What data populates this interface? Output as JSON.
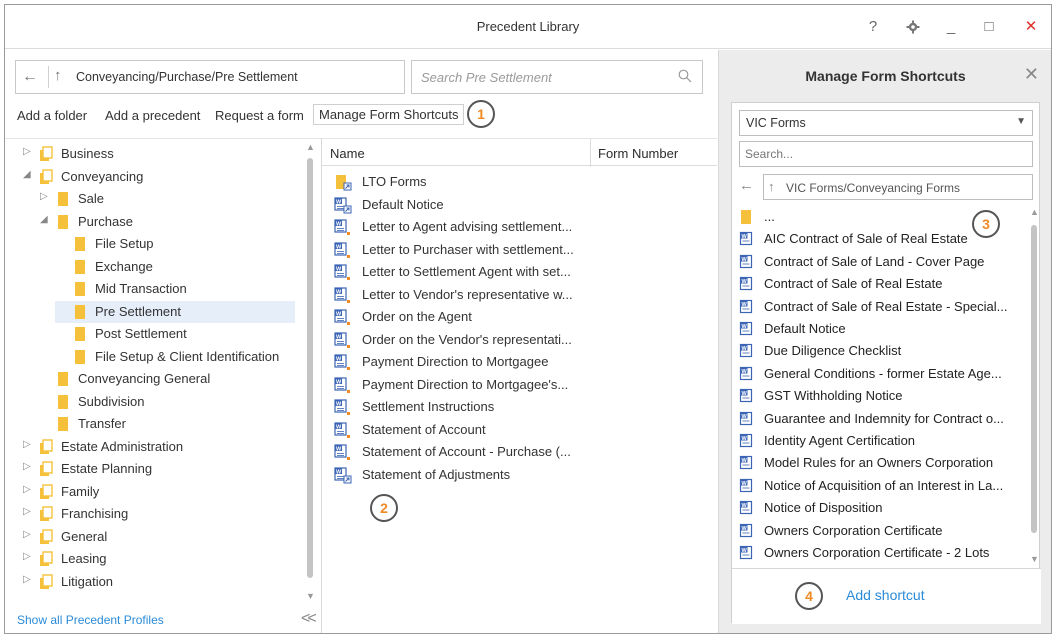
{
  "window": {
    "title": "Precedent Library",
    "controls": {
      "help": "?",
      "minimize": "_",
      "maximize": "□",
      "close": "✕"
    }
  },
  "nav": {
    "path": "Conveyancing/Purchase/Pre Settlement",
    "search_placeholder": "Search Pre Settlement"
  },
  "toolbar": {
    "add_folder": "Add a folder",
    "add_precedent": "Add a precedent",
    "request_form": "Request a form",
    "manage_shortcuts": "Manage Form Shortcuts"
  },
  "callouts": [
    "1",
    "2",
    "3",
    "4"
  ],
  "tree": [
    {
      "label": "Business",
      "level": 0,
      "expander": "collapsed",
      "icon": "multi-folder-icon"
    },
    {
      "label": "Conveyancing",
      "level": 0,
      "expander": "expanded",
      "icon": "multi-folder-icon"
    },
    {
      "label": "Sale",
      "level": 1,
      "expander": "collapsed",
      "icon": "folder-icon"
    },
    {
      "label": "Purchase",
      "level": 1,
      "expander": "expanded",
      "icon": "folder-icon"
    },
    {
      "label": "File Setup",
      "level": 2,
      "expander": "none",
      "icon": "folder-icon"
    },
    {
      "label": "Exchange",
      "level": 2,
      "expander": "none",
      "icon": "folder-icon"
    },
    {
      "label": "Mid Transaction",
      "level": 2,
      "expander": "none",
      "icon": "folder-icon"
    },
    {
      "label": "Pre Settlement",
      "level": 2,
      "expander": "none",
      "icon": "folder-icon",
      "selected": true
    },
    {
      "label": "Post Settlement",
      "level": 2,
      "expander": "none",
      "icon": "folder-icon"
    },
    {
      "label": "File Setup & Client Identification",
      "level": 2,
      "expander": "none",
      "icon": "folder-icon"
    },
    {
      "label": "Conveyancing General",
      "level": 1,
      "expander": "none",
      "icon": "folder-icon"
    },
    {
      "label": "Subdivision",
      "level": 1,
      "expander": "none",
      "icon": "folder-icon"
    },
    {
      "label": "Transfer",
      "level": 1,
      "expander": "none",
      "icon": "folder-icon"
    },
    {
      "label": "Estate Administration",
      "level": 0,
      "expander": "collapsed",
      "icon": "multi-folder-icon"
    },
    {
      "label": "Estate Planning",
      "level": 0,
      "expander": "collapsed",
      "icon": "multi-folder-icon"
    },
    {
      "label": "Family",
      "level": 0,
      "expander": "collapsed",
      "icon": "multi-folder-icon"
    },
    {
      "label": "Franchising",
      "level": 0,
      "expander": "collapsed",
      "icon": "multi-folder-icon"
    },
    {
      "label": "General",
      "level": 0,
      "expander": "collapsed",
      "icon": "multi-folder-icon"
    },
    {
      "label": "Leasing",
      "level": 0,
      "expander": "collapsed",
      "icon": "multi-folder-icon"
    },
    {
      "label": "Litigation",
      "level": 0,
      "expander": "collapsed",
      "icon": "multi-folder-icon"
    }
  ],
  "footer": {
    "show_all": "Show all Precedent Profiles",
    "collapse": "<<"
  },
  "list": {
    "columns": [
      "Name",
      "Form Number"
    ],
    "rows": [
      {
        "name": "LTO Forms",
        "icon": "folder-shortcut-icon"
      },
      {
        "name": "Default Notice",
        "icon": "word-shortcut-icon"
      },
      {
        "name": "Letter to Agent advising settlement...",
        "icon": "word-doc-icon"
      },
      {
        "name": "Letter to Purchaser with settlement...",
        "icon": "word-doc-icon"
      },
      {
        "name": "Letter to Settlement Agent with set...",
        "icon": "word-doc-icon"
      },
      {
        "name": "Letter to Vendor's representative w...",
        "icon": "word-doc-icon"
      },
      {
        "name": "Order on the Agent",
        "icon": "word-doc-icon"
      },
      {
        "name": "Order on the Vendor's representati...",
        "icon": "word-doc-icon"
      },
      {
        "name": "Payment Direction to Mortgagee",
        "icon": "word-doc-icon"
      },
      {
        "name": "Payment Direction to Mortgagee's...",
        "icon": "word-doc-icon"
      },
      {
        "name": "Settlement Instructions",
        "icon": "word-doc-icon"
      },
      {
        "name": "Statement of Account",
        "icon": "word-doc-icon"
      },
      {
        "name": "Statement of Account - Purchase (...",
        "icon": "word-doc-icon"
      },
      {
        "name": "Statement of Adjustments",
        "icon": "word-shortcut-icon"
      }
    ]
  },
  "shortcuts_panel": {
    "title": "Manage Form Shortcuts",
    "close": "✕",
    "dropdown_value": "VIC Forms",
    "search_placeholder": "Search...",
    "path": "VIC Forms/Conveyancing Forms",
    "items": [
      {
        "name": "...",
        "icon": "folder-icon"
      },
      {
        "name": "AIC Contract of Sale of Real Estate",
        "icon": "word-icon"
      },
      {
        "name": "Contract of Sale of Land - Cover Page",
        "icon": "word-icon"
      },
      {
        "name": "Contract of Sale of Real Estate",
        "icon": "word-icon"
      },
      {
        "name": "Contract of Sale of Real Estate - Special...",
        "icon": "word-icon"
      },
      {
        "name": "Default Notice",
        "icon": "word-icon"
      },
      {
        "name": "Due Diligence Checklist",
        "icon": "word-icon"
      },
      {
        "name": "General Conditions - former Estate Age...",
        "icon": "word-icon"
      },
      {
        "name": "GST Withholding Notice",
        "icon": "word-icon"
      },
      {
        "name": "Guarantee and Indemnity for Contract o...",
        "icon": "word-icon"
      },
      {
        "name": "Identity Agent Certification",
        "icon": "word-icon"
      },
      {
        "name": "Model Rules for an Owners Corporation",
        "icon": "word-icon"
      },
      {
        "name": "Notice of Acquisition of an Interest in La...",
        "icon": "word-icon"
      },
      {
        "name": "Notice of Disposition",
        "icon": "word-icon"
      },
      {
        "name": "Owners Corporation Certificate",
        "icon": "word-icon"
      },
      {
        "name": "Owners Corporation Certificate - 2 Lots",
        "icon": "word-icon"
      }
    ],
    "add_shortcut": "Add shortcut"
  },
  "colors": {
    "accent_blue": "#2a8bd8",
    "folder_yellow": "#f6c13a",
    "callout_orange": "#f08a24",
    "selection": "#e5eef9",
    "close_red": "#e0302c"
  }
}
